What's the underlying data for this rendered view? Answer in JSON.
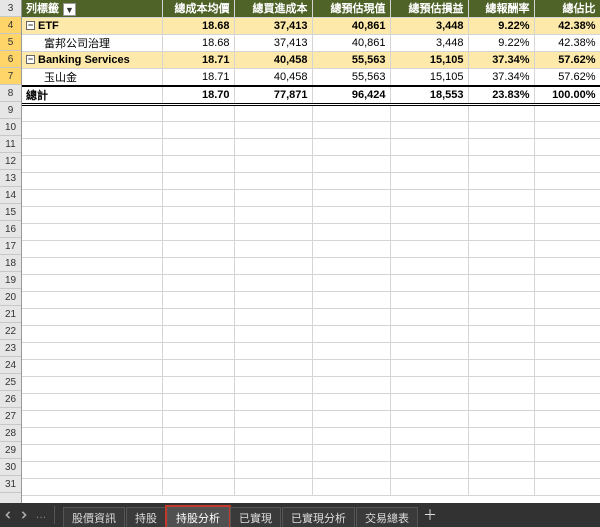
{
  "chart_data": {
    "type": "table",
    "title": "持股分析",
    "columns": [
      "列標籤",
      "總成本均價",
      "總買進成本",
      "總預估現值",
      "總預估損益",
      "總報酬率",
      "總佔比"
    ],
    "rows": [
      {
        "label": "ETF",
        "cost_avg": 18.68,
        "cost_total": 37413,
        "est_value": 40861,
        "est_pl": 3448,
        "return_pct": 9.22,
        "weight_pct": 42.38,
        "level": "group"
      },
      {
        "label": "富邦公司治理",
        "cost_avg": 18.68,
        "cost_total": 37413,
        "est_value": 40861,
        "est_pl": 3448,
        "return_pct": 9.22,
        "weight_pct": 42.38,
        "level": "leaf"
      },
      {
        "label": "Banking Services",
        "cost_avg": 18.71,
        "cost_total": 40458,
        "est_value": 55563,
        "est_pl": 15105,
        "return_pct": 37.34,
        "weight_pct": 57.62,
        "level": "group"
      },
      {
        "label": "玉山金",
        "cost_avg": 18.71,
        "cost_total": 40458,
        "est_value": 55563,
        "est_pl": 15105,
        "return_pct": 37.34,
        "weight_pct": 57.62,
        "level": "leaf"
      },
      {
        "label": "總計",
        "cost_avg": 18.7,
        "cost_total": 77871,
        "est_value": 96424,
        "est_pl": 18553,
        "return_pct": 23.83,
        "weight_pct": 100.0,
        "level": "total"
      }
    ]
  },
  "header": {
    "c0": "列標籤",
    "c1": "總成本均價",
    "c2": "總買進成本",
    "c3": "總預估現值",
    "c4": "總預估損益",
    "c5": "總報酬率",
    "c6": "總佔比"
  },
  "rownums": [
    "3",
    "4",
    "5",
    "6",
    "7",
    "8",
    "9",
    "10",
    "11",
    "12",
    "13",
    "14",
    "15",
    "16",
    "17",
    "18",
    "19",
    "20",
    "21",
    "22",
    "23",
    "24",
    "25",
    "26",
    "27",
    "28",
    "29",
    "30",
    "31"
  ],
  "rows": {
    "r0": {
      "lab": "ETF",
      "a": "18.68",
      "b": "37,413",
      "c": "40,861",
      "d": "3,448",
      "e": "9.22%",
      "f": "42.38%"
    },
    "r1": {
      "lab": "富邦公司治理",
      "a": "18.68",
      "b": "37,413",
      "c": "40,861",
      "d": "3,448",
      "e": "9.22%",
      "f": "42.38%"
    },
    "r2": {
      "lab": "Banking Services",
      "a": "18.71",
      "b": "40,458",
      "c": "55,563",
      "d": "15,105",
      "e": "37.34%",
      "f": "57.62%"
    },
    "r3": {
      "lab": "玉山金",
      "a": "18.71",
      "b": "40,458",
      "c": "55,563",
      "d": "15,105",
      "e": "37.34%",
      "f": "57.62%"
    },
    "r4": {
      "lab": "總計",
      "a": "18.70",
      "b": "77,871",
      "c": "96,424",
      "d": "18,553",
      "e": "23.83%",
      "f": "100.00%"
    }
  },
  "tabs": {
    "t0": "股價資訊",
    "t1": "持股",
    "t2": "持股分析",
    "t3": "已實現",
    "t4": "已實現分析",
    "t5": "交易總表"
  },
  "icons": {
    "collapse": "−",
    "dropdown": "▼",
    "add": "＋",
    "dots": "…"
  }
}
